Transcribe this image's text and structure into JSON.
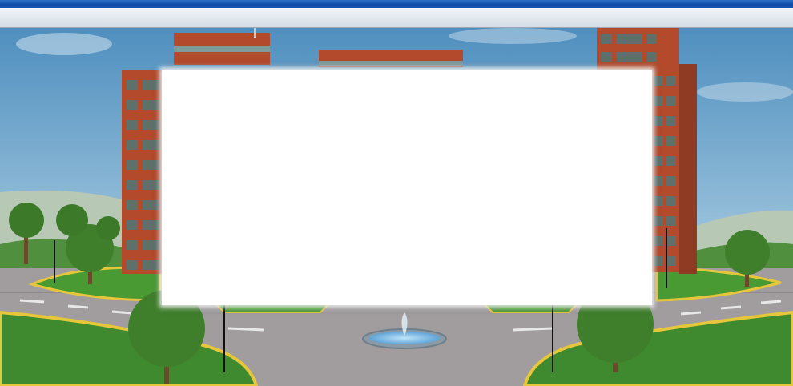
{
  "window": {
    "title": ""
  },
  "toolbar": {
    "items": []
  },
  "scene": {
    "description_icon": "office-campus-backdrop"
  },
  "panel": {
    "content": ""
  },
  "colors": {
    "titlebar": "#0e4aa8",
    "sky": "#6ea3c9",
    "grass": "#3f8a2e",
    "road": "#9b9799",
    "building": "#b34a2c"
  }
}
